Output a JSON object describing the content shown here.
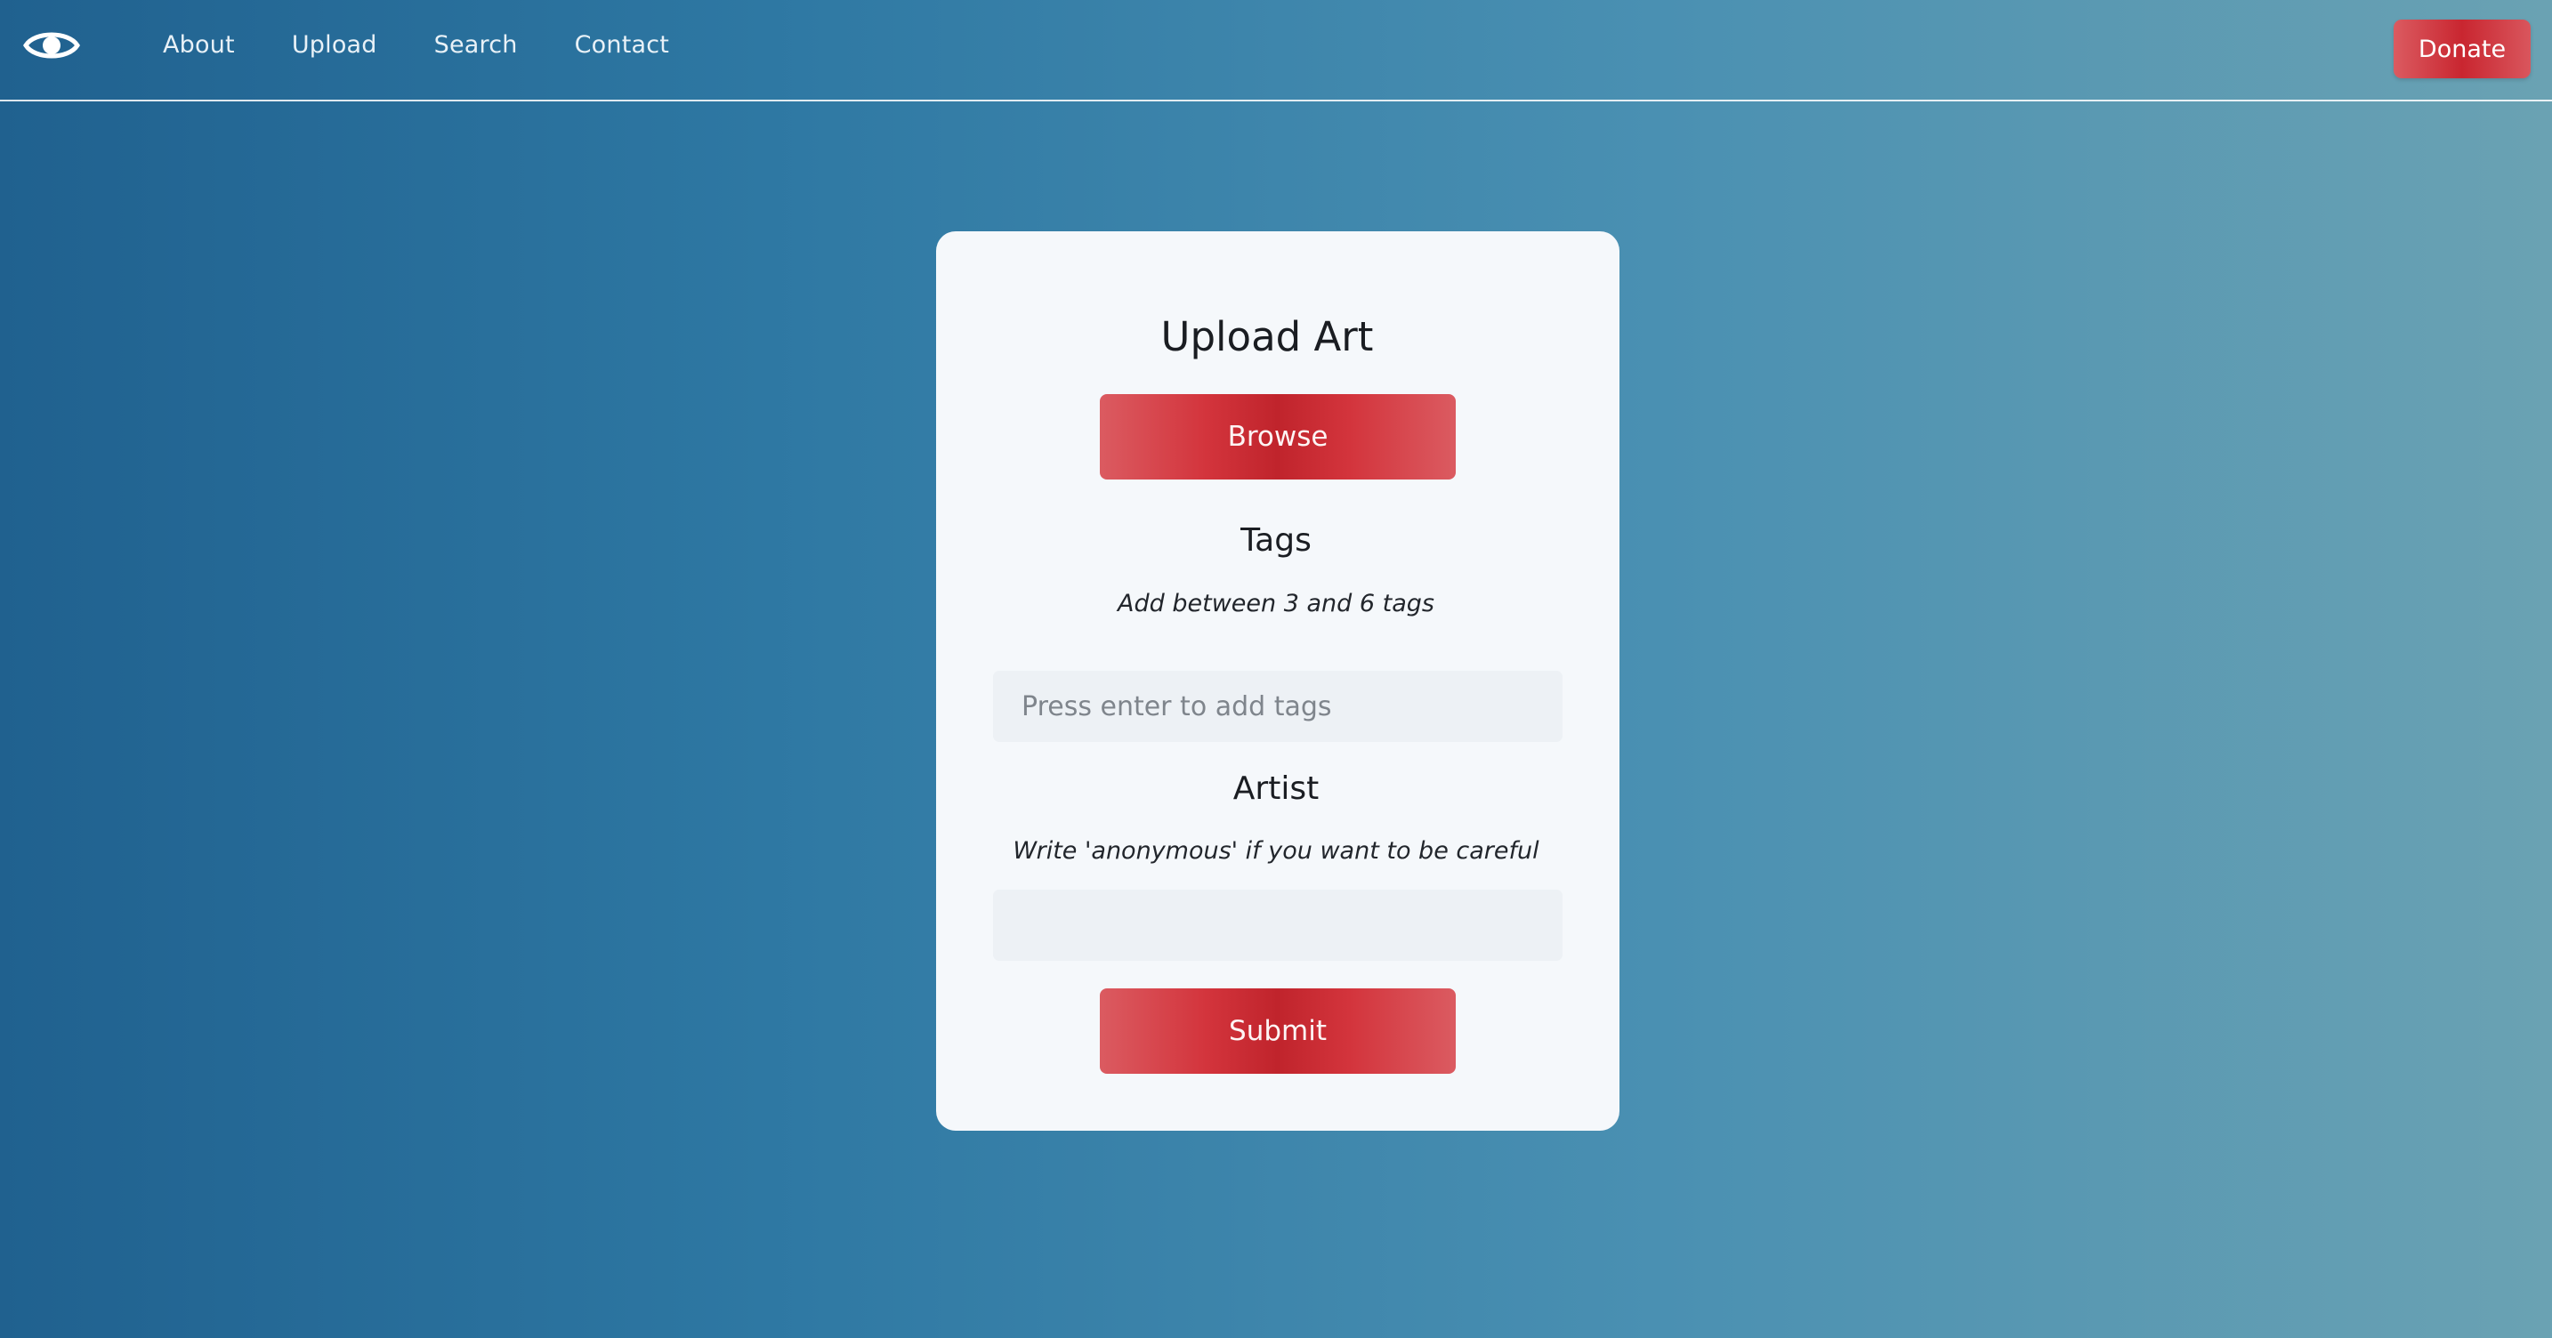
{
  "nav": {
    "logo_icon": "eye-icon",
    "links": [
      {
        "label": "About"
      },
      {
        "label": "Upload"
      },
      {
        "label": "Search"
      },
      {
        "label": "Contact"
      }
    ],
    "donate_label": "Donate"
  },
  "form": {
    "title": "Upload Art",
    "browse_label": "Browse",
    "tags": {
      "heading": "Tags",
      "hint": "Add between 3 and 6 tags",
      "placeholder": "Press enter to add tags",
      "value": ""
    },
    "artist": {
      "heading": "Artist",
      "hint": "Write 'anonymous' if you want to be careful",
      "placeholder": "",
      "value": ""
    },
    "submit_label": "Submit"
  },
  "colors": {
    "accent_red": "#c92630",
    "background_start": "#20618f",
    "background_end": "#6aa2b3",
    "card": "#f5f8fb",
    "field": "#edf1f5"
  }
}
